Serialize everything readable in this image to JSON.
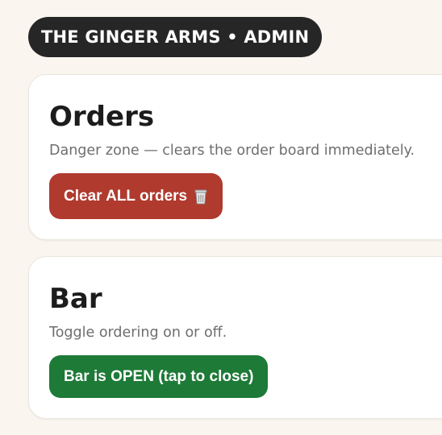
{
  "header": {
    "title": "THE GINGER ARMS • ADMIN"
  },
  "orders_card": {
    "title": "Orders",
    "description": "Danger zone — clears the order board immediately.",
    "clear_button_label": "Clear ALL orders",
    "clear_button_icon": "trash-can-icon"
  },
  "bar_card": {
    "title": "Bar",
    "description": "Toggle ordering on or off.",
    "toggle_button_label": "Bar is OPEN (tap to close)"
  },
  "colors": {
    "background": "#faf5ef",
    "header_pill": "#262626",
    "danger_button": "#b03a2e",
    "open_button": "#1e7a37"
  }
}
